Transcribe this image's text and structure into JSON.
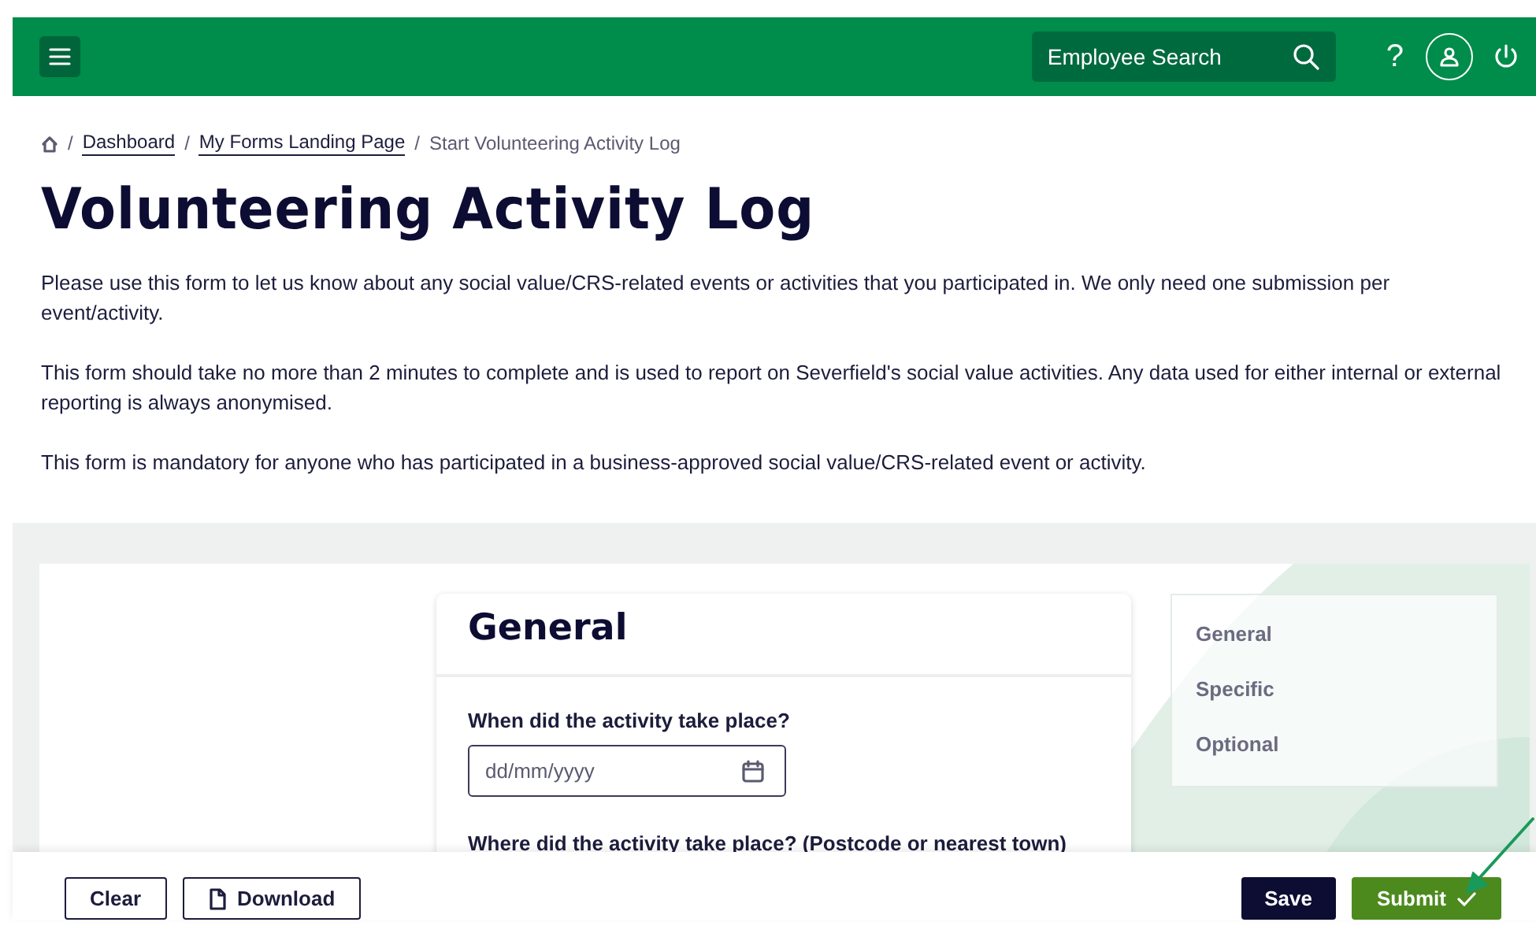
{
  "header": {
    "search": {
      "label": "Employee Search"
    },
    "help": "?"
  },
  "breadcrumb_separator": "/",
  "breadcrumb": [
    {
      "label": "Dashboard",
      "kind": "link"
    },
    {
      "label": "My Forms Landing Page",
      "kind": "link"
    },
    {
      "label": "Start Volunteering Activity Log",
      "kind": "current"
    }
  ],
  "title": "Volunteering Activity Log",
  "paragraphs": [
    "Please use this form to let us know about any social value/CRS-related events or activities that you participated in. We only need one submission per event/activity.",
    "This form should take no more than 2 minutes to complete and is used to report on Severfield's social value activities. Any data used for either internal or external reporting is always anonymised.",
    "This form is mandatory for anyone who has participated in a business-approved social value/CRS-related event or activity."
  ],
  "form": {
    "section_title": "General",
    "fields": [
      {
        "label": "When did the activity take place?",
        "kind": "date",
        "placeholder": "dd/mm/yyyy"
      },
      {
        "label": "Where did the activity take place? (Postcode or nearest town)",
        "kind": "text"
      }
    ]
  },
  "section_nav": [
    {
      "label": "General",
      "selected": false
    },
    {
      "label": "Specific",
      "selected": false
    },
    {
      "label": "Optional",
      "selected": false
    }
  ],
  "actions": {
    "left": [
      {
        "label": "Clear",
        "kind": "plain"
      },
      {
        "label": "Download",
        "kind": "pdf"
      }
    ],
    "right": [
      {
        "label": "Save",
        "kind": "dark"
      },
      {
        "label": "Submit",
        "kind": "submit"
      }
    ]
  }
}
